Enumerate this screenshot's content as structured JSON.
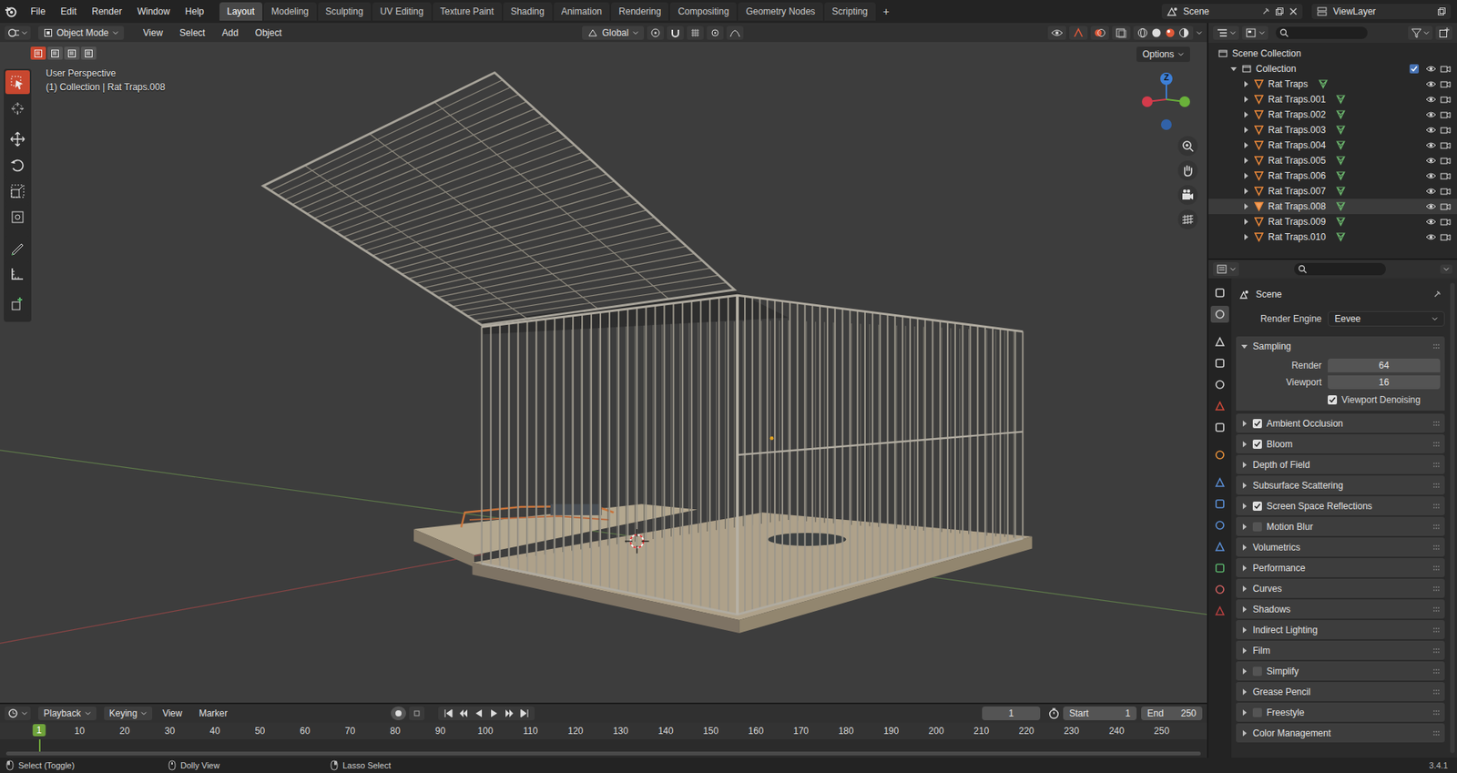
{
  "window": {
    "title": "Blender"
  },
  "menu": [
    "File",
    "Edit",
    "Render",
    "Window",
    "Help"
  ],
  "workspaces": [
    {
      "label": "Layout",
      "selected": true
    },
    {
      "label": "Modeling",
      "selected": false
    },
    {
      "label": "Sculpting",
      "selected": false
    },
    {
      "label": "UV Editing",
      "selected": false
    },
    {
      "label": "Texture Paint",
      "selected": false
    },
    {
      "label": "Shading",
      "selected": false
    },
    {
      "label": "Animation",
      "selected": false
    },
    {
      "label": "Rendering",
      "selected": false
    },
    {
      "label": "Compositing",
      "selected": false
    },
    {
      "label": "Geometry Nodes",
      "selected": false
    },
    {
      "label": "Scripting",
      "selected": false
    }
  ],
  "add_tab": "+",
  "scene": "Scene",
  "view_layer": "ViewLayer",
  "viewport_header": {
    "mode": "Object Mode",
    "menus": [
      "View",
      "Select",
      "Add",
      "Object"
    ],
    "orientation": "Global",
    "options": "Options"
  },
  "select_modes": [
    {
      "selected": true
    },
    {
      "selected": false
    },
    {
      "selected": false
    },
    {
      "selected": false
    }
  ],
  "viewport": {
    "perspective": "User Perspective",
    "context": "(1) Collection | Rat Traps.008",
    "gizmo_z": "Z"
  },
  "tools": [
    {
      "selected": true
    },
    {
      "selected": false
    },
    {
      "selected": false
    },
    {
      "selected": false
    },
    {
      "selected": false
    },
    {
      "selected": false
    },
    {
      "selected": false
    },
    {
      "selected": false
    },
    {
      "selected": false
    }
  ],
  "outliner": {
    "root": "Scene Collection",
    "collection": {
      "name": "Collection",
      "checked": true,
      "expanded": true
    },
    "items": [
      {
        "name": "Rat Traps",
        "selected": false
      },
      {
        "name": "Rat Traps.001",
        "selected": false
      },
      {
        "name": "Rat Traps.002",
        "selected": false
      },
      {
        "name": "Rat Traps.003",
        "selected": false
      },
      {
        "name": "Rat Traps.004",
        "selected": false
      },
      {
        "name": "Rat Traps.005",
        "selected": false
      },
      {
        "name": "Rat Traps.006",
        "selected": false
      },
      {
        "name": "Rat Traps.007",
        "selected": false
      },
      {
        "name": "Rat Traps.008",
        "selected": true
      },
      {
        "name": "Rat Traps.009",
        "selected": false
      },
      {
        "name": "Rat Traps.010",
        "selected": false
      }
    ]
  },
  "properties": {
    "title": "Scene",
    "render_engine_label": "Render Engine",
    "render_engine": "Eevee",
    "tabs": [
      {
        "selected": false,
        "color": "#cfcfcf"
      },
      {
        "selected": true,
        "color": "#cfcfcf"
      },
      {
        "selected": false,
        "color": "#cfcfcf"
      },
      {
        "selected": false,
        "color": "#cfcfcf"
      },
      {
        "selected": false,
        "color": "#cfcfcf"
      },
      {
        "selected": false,
        "color": "#d24a3a"
      },
      {
        "selected": false,
        "color": "#cfcfcf"
      },
      {
        "selected": false,
        "color": "#e8913a"
      },
      {
        "selected": false,
        "color": "#5b8fd6"
      },
      {
        "selected": false,
        "color": "#5b8fd6"
      },
      {
        "selected": false,
        "color": "#5b8fd6"
      },
      {
        "selected": false,
        "color": "#5b8fd6"
      },
      {
        "selected": false,
        "color": "#58b06a"
      },
      {
        "selected": false,
        "color": "#d06060"
      },
      {
        "selected": false,
        "color": "#b84040"
      }
    ],
    "sampling": {
      "label": "Sampling",
      "expanded": true,
      "render_label": "Render",
      "render": "64",
      "viewport_label": "Viewport",
      "viewport": "16",
      "denoise": {
        "label": "Viewport Denoising",
        "checked": true
      }
    },
    "panels": [
      {
        "label": "Ambient Occlusion",
        "kind": "checkbox",
        "checked": true
      },
      {
        "label": "Bloom",
        "kind": "checkbox",
        "checked": true
      },
      {
        "label": "Depth of Field",
        "kind": "plain",
        "checked": false
      },
      {
        "label": "Subsurface Scattering",
        "kind": "plain",
        "checked": false
      },
      {
        "label": "Screen Space Reflections",
        "kind": "checkbox",
        "checked": true
      },
      {
        "label": "Motion Blur",
        "kind": "checkbox",
        "checked": false
      },
      {
        "label": "Volumetrics",
        "kind": "plain",
        "checked": false
      },
      {
        "label": "Performance",
        "kind": "plain",
        "checked": false
      },
      {
        "label": "Curves",
        "kind": "plain",
        "checked": false
      },
      {
        "label": "Shadows",
        "kind": "plain",
        "checked": false
      },
      {
        "label": "Indirect Lighting",
        "kind": "plain",
        "checked": false
      },
      {
        "label": "Film",
        "kind": "plain",
        "checked": false
      },
      {
        "label": "Simplify",
        "kind": "checkbox",
        "checked": false
      },
      {
        "label": "Grease Pencil",
        "kind": "plain",
        "checked": false
      },
      {
        "label": "Freestyle",
        "kind": "checkbox",
        "checked": false
      },
      {
        "label": "Color Management",
        "kind": "plain",
        "checked": false
      }
    ]
  },
  "timeline": {
    "menus": [
      "Playback",
      "Keying",
      "View",
      "Marker"
    ],
    "current_frame": "1",
    "start_label": "Start",
    "start": "1",
    "end_label": "End",
    "end": "250",
    "ruler": [
      "1",
      "10",
      "20",
      "30",
      "40",
      "50",
      "60",
      "70",
      "80",
      "90",
      "100",
      "110",
      "120",
      "130",
      "140",
      "150",
      "160",
      "170",
      "180",
      "190",
      "200",
      "210",
      "220",
      "230",
      "240",
      "250"
    ]
  },
  "status_bar": {
    "items": [
      "Select (Toggle)",
      "Dolly View",
      "Lasso Select"
    ],
    "version": "3.4.1"
  }
}
